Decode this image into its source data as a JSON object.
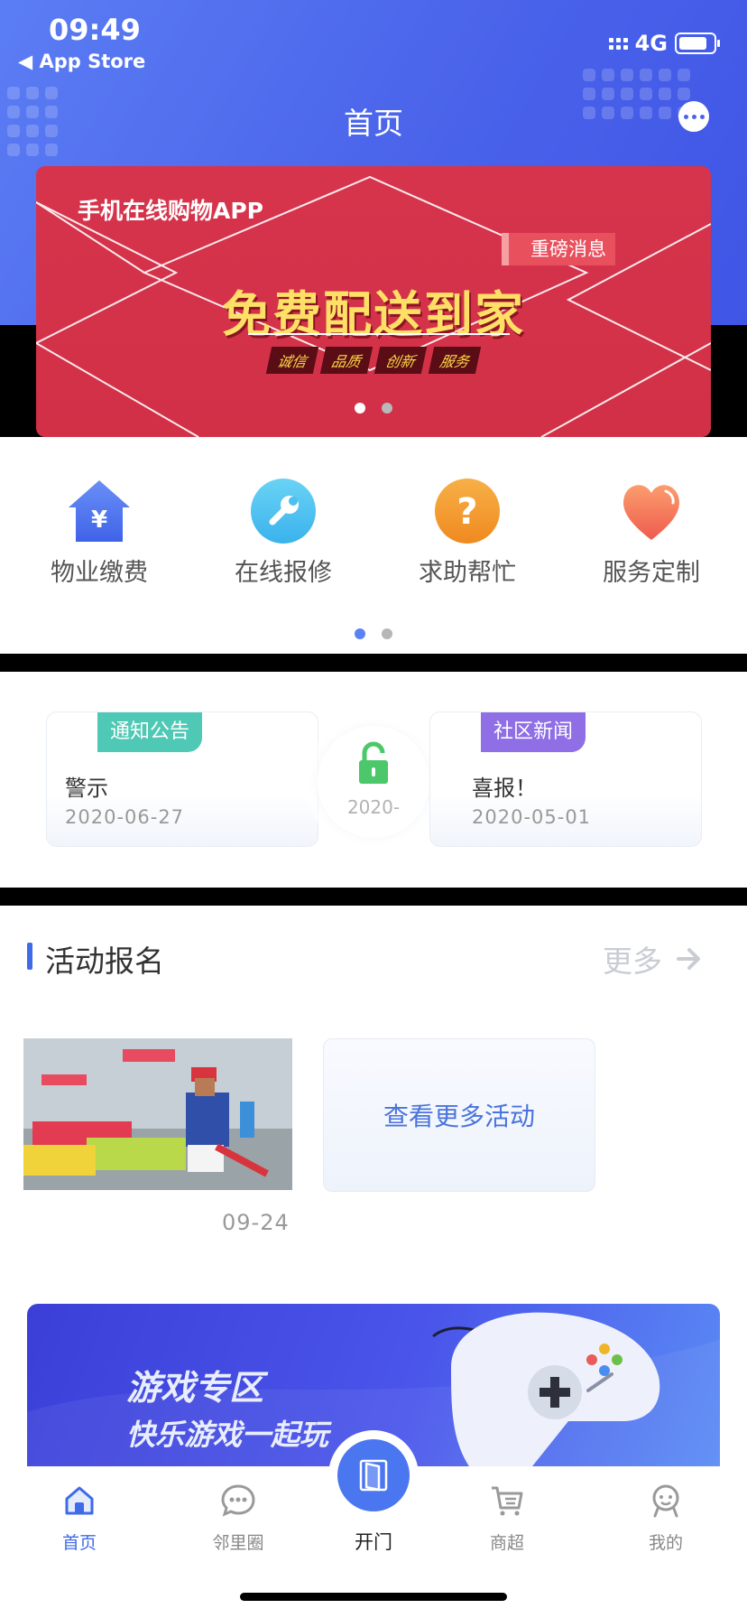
{
  "status_bar": {
    "time": "09:49",
    "back_label": "◀ App Store",
    "network": "4G"
  },
  "header": {
    "title": "首页"
  },
  "banner": {
    "app_text": "手机在线购物APP",
    "tag": "重磅消息",
    "headline": "免费配送到家",
    "subtags": [
      "诚信",
      "品质",
      "创新",
      "服务"
    ],
    "page_count": 2,
    "active_page": 1
  },
  "quick_menu": {
    "items": [
      {
        "label": "物业缴费",
        "icon": "house-yen-icon"
      },
      {
        "label": "在线报修",
        "icon": "wrench-icon"
      },
      {
        "label": "求助帮忙",
        "icon": "question-icon"
      },
      {
        "label": "服务定制",
        "icon": "heart-icon"
      }
    ],
    "page_count": 2,
    "active_page": 1
  },
  "notices": [
    {
      "badge": "通知公告",
      "title": "警示",
      "date": "2020-06-27",
      "badge_color": "#4fc9b5"
    },
    {
      "badge": "社区新闻",
      "title": "喜报！",
      "date": "2020-05-01",
      "badge_color": "#8f6ee6"
    }
  ],
  "notice_center": {
    "date": "2020-"
  },
  "activity": {
    "section_title": "活动报名",
    "more_label": "更多",
    "cards": [
      {
        "date": "09-24"
      }
    ],
    "more_card_label": "查看更多活动"
  },
  "game_banner": {
    "line1": "游戏专区",
    "line2": "快乐游戏一起玩"
  },
  "tabbar": {
    "items": [
      {
        "label": "首页",
        "icon": "home-icon",
        "active": true
      },
      {
        "label": "邻里圈",
        "icon": "chat-bubble-icon",
        "active": false
      },
      {
        "label": "开门",
        "icon": "door-icon",
        "active": false
      },
      {
        "label": "商超",
        "icon": "cart-icon",
        "active": false
      },
      {
        "label": "我的",
        "icon": "person-icon",
        "active": false
      }
    ]
  },
  "colors": {
    "primary": "#4a63ea",
    "accent_blue": "#3f6ae8",
    "banner_red": "#d6344c",
    "active_tab": "#3f6ae8"
  }
}
